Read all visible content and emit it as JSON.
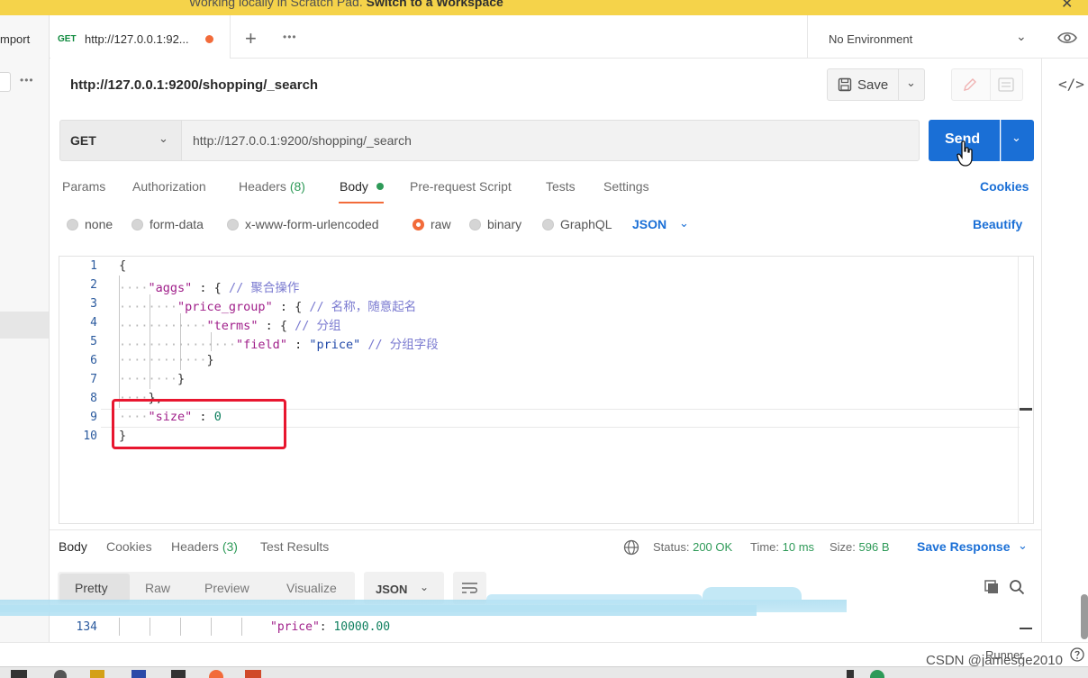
{
  "banner": {
    "text": "Working locally in Scratch Pad.",
    "link": "Switch to a Workspace"
  },
  "sidebar": {
    "import_label": "mport"
  },
  "tabs": [
    {
      "method": "GET",
      "label": "http://127.0.0.1:92..."
    }
  ],
  "environment": {
    "label": "No Environment"
  },
  "request": {
    "title": "http://127.0.0.1:9200/shopping/_search",
    "save_label": "Save",
    "method": "GET",
    "url": "http://127.0.0.1:9200/shopping/_search",
    "send_label": "Send",
    "tabs": {
      "params": "Params",
      "authorization": "Authorization",
      "headers": "Headers",
      "headers_count": "(8)",
      "body": "Body",
      "pre_request": "Pre-request Script",
      "tests": "Tests",
      "settings": "Settings"
    },
    "cookies_label": "Cookies",
    "body_types": {
      "none": "none",
      "form_data": "form-data",
      "urlencoded": "x-www-form-urlencoded",
      "raw": "raw",
      "binary": "binary",
      "graphql": "GraphQL"
    },
    "body_format": "JSON",
    "beautify_label": "Beautify",
    "line_numbers": [
      "1",
      "2",
      "3",
      "4",
      "5",
      "6",
      "7",
      "8",
      "9",
      "10"
    ],
    "code": {
      "l1": "{",
      "l2_key": "\"aggs\"",
      "l2_rest": " : { ",
      "l2_comment": "// 聚合操作",
      "l3_key": "\"price_group\"",
      "l3_rest": " : { ",
      "l3_comment": "// 名称，随意起名",
      "l4_key": "\"terms\"",
      "l4_rest": " : { ",
      "l4_comment": "// 分组",
      "l5_key": "\"field\"",
      "l5_colon": " : ",
      "l5_value": "\"price\"",
      "l5_comment": " // 分组字段",
      "l6": "}",
      "l7": "}",
      "l8": "},",
      "l9_key": "\"size\"",
      "l9_colon": " : ",
      "l9_value": "0",
      "l10": "}"
    }
  },
  "response": {
    "tabs": {
      "body": "Body",
      "cookies": "Cookies",
      "headers": "Headers",
      "headers_count": "(3)",
      "test_results": "Test Results"
    },
    "status_label": "Status:",
    "status_value": "200 OK",
    "time_label": "Time:",
    "time_value": "10 ms",
    "size_label": "Size:",
    "size_value": "596 B",
    "save_response_label": "Save Response",
    "view_modes": {
      "pretty": "Pretty",
      "raw": "Raw",
      "preview": "Preview",
      "visualize": "Visualize"
    },
    "format": "JSON",
    "line_number": "134",
    "line_key": "\"price\"",
    "line_colon": ": ",
    "line_value": "10000.00"
  },
  "statusbar": {
    "runner_label": "Runner"
  },
  "watermark": "CSDN @jamesge2010",
  "colors": {
    "accent": "#1a6fd6",
    "active_tab": "#f26b3a",
    "success": "#2e9a58",
    "highlight_box": "#e8162f",
    "banner": "#f5d34a"
  }
}
